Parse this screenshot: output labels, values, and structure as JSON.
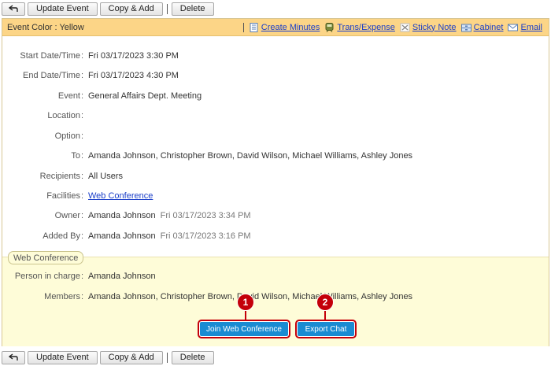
{
  "toolbar": {
    "back_label": "⬑",
    "update_label": "Update Event",
    "copy_label": "Copy & Add",
    "delete_label": "Delete"
  },
  "color_bar": {
    "label": "Event Color : Yellow",
    "links": {
      "create_minutes": "Create Minutes",
      "trans_expense": "Trans/Expense",
      "sticky_note": "Sticky Note",
      "cabinet": "Cabinet",
      "email": "Email"
    }
  },
  "details": {
    "start": {
      "label": "Start Date/Time",
      "value": "Fri 03/17/2023 3:30 PM"
    },
    "end": {
      "label": "End Date/Time",
      "value": "Fri 03/17/2023 4:30 PM"
    },
    "event": {
      "label": "Event",
      "value": "General Affairs Dept. Meeting"
    },
    "location": {
      "label": "Location",
      "value": ""
    },
    "option": {
      "label": "Option",
      "value": ""
    },
    "to": {
      "label": "To",
      "value": "Amanda Johnson, Christopher Brown, David Wilson, Michael Williams, Ashley Jones"
    },
    "recipients": {
      "label": "Recipients",
      "value": "All Users"
    },
    "facilities": {
      "label": "Facilities",
      "value": "Web Conference"
    },
    "owner": {
      "label": "Owner",
      "value": "Amanda Johnson",
      "time": "Fri 03/17/2023 3:34 PM"
    },
    "added_by": {
      "label": "Added By",
      "value": "Amanda Johnson",
      "time": "Fri 03/17/2023 3:16 PM"
    }
  },
  "web_conference": {
    "title": "Web Conference",
    "person": {
      "label": "Person in charge",
      "value": "Amanda Johnson"
    },
    "members": {
      "label": "Members",
      "value": "Amanda Johnson, Christopher Brown, David Wilson, Michael Williams, Ashley Jones"
    },
    "join_label": "Join Web Conference",
    "export_label": "Export Chat",
    "marker_1": "1",
    "marker_2": "2"
  },
  "colors": {
    "accent": "#1a8bd2",
    "color_bar": "#fcd587",
    "conference_bg": "#fefcd8",
    "marker": "#c4000a",
    "link": "#1a3ec9"
  }
}
